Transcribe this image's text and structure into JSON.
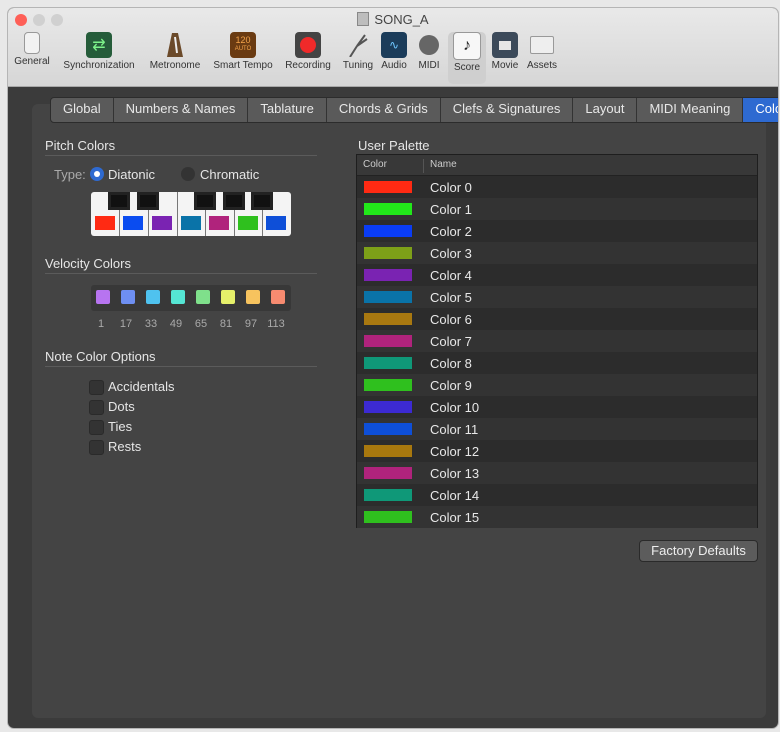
{
  "window_title": "SONG_A",
  "toolbar": [
    {
      "label": "General",
      "icon": "switch-icon"
    },
    {
      "label": "Synchronization",
      "icon": "sync-arrows-icon"
    },
    {
      "label": "Metronome",
      "icon": "metronome-icon"
    },
    {
      "label": "Smart Tempo",
      "icon": "smart-tempo-icon",
      "badge": "120"
    },
    {
      "label": "Recording",
      "icon": "record-icon"
    },
    {
      "label": "Tuning",
      "icon": "tuning-fork-icon"
    },
    {
      "label": "Audio",
      "icon": "waveform-icon"
    },
    {
      "label": "MIDI",
      "icon": "midi-port-icon"
    },
    {
      "label": "Score",
      "icon": "music-note-icon"
    },
    {
      "label": "Movie",
      "icon": "video-camera-icon"
    },
    {
      "label": "Assets",
      "icon": "briefcase-icon"
    }
  ],
  "tabs": [
    "Global",
    "Numbers & Names",
    "Tablature",
    "Chords & Grids",
    "Clefs & Signatures",
    "Layout",
    "MIDI Meaning",
    "Colors"
  ],
  "active_tab": "Colors",
  "pitch_colors": {
    "title": "Pitch Colors",
    "type_label": "Type:",
    "option_diatonic": "Diatonic",
    "option_chromatic": "Chromatic",
    "selected": "Diatonic",
    "key_colors": [
      "#ff2a13",
      "#0a4cf0",
      "#7a23b2",
      "#0a73a8",
      "#b0237c",
      "#2fc01e",
      "#0e4fd8"
    ]
  },
  "velocity_colors": {
    "title": "Velocity Colors",
    "values": [
      "1",
      "17",
      "33",
      "49",
      "65",
      "81",
      "97",
      "113"
    ],
    "colors": [
      "#b774f0",
      "#6e8ff2",
      "#4fc2ef",
      "#55e6d4",
      "#7fe08b",
      "#e6f06a",
      "#f7c35e",
      "#f78b70"
    ]
  },
  "note_color_options": {
    "title": "Note Color Options",
    "options": [
      {
        "label": "Accidentals",
        "checked": false
      },
      {
        "label": "Dots",
        "checked": false
      },
      {
        "label": "Ties",
        "checked": false
      },
      {
        "label": "Rests",
        "checked": false
      }
    ]
  },
  "user_palette": {
    "title": "User Palette",
    "col_color": "Color",
    "col_name": "Name",
    "rows": [
      {
        "name": "Color 0",
        "color": "#ff2a13"
      },
      {
        "name": "Color 1",
        "color": "#22e81a"
      },
      {
        "name": "Color 2",
        "color": "#0a3cf4"
      },
      {
        "name": "Color 3",
        "color": "#7da018"
      },
      {
        "name": "Color 4",
        "color": "#7a23b2"
      },
      {
        "name": "Color 5",
        "color": "#0a73a8"
      },
      {
        "name": "Color 6",
        "color": "#a87810"
      },
      {
        "name": "Color 7",
        "color": "#b0237c"
      },
      {
        "name": "Color 8",
        "color": "#0f9878"
      },
      {
        "name": "Color 9",
        "color": "#2fc01e"
      },
      {
        "name": "Color 10",
        "color": "#3c2ad2"
      },
      {
        "name": "Color 11",
        "color": "#0e4fd8"
      },
      {
        "name": "Color 12",
        "color": "#a8780e"
      },
      {
        "name": "Color 13",
        "color": "#b0237c"
      },
      {
        "name": "Color 14",
        "color": "#0f9878"
      },
      {
        "name": "Color 15",
        "color": "#2fc01e"
      }
    ]
  },
  "factory_defaults_label": "Factory Defaults"
}
